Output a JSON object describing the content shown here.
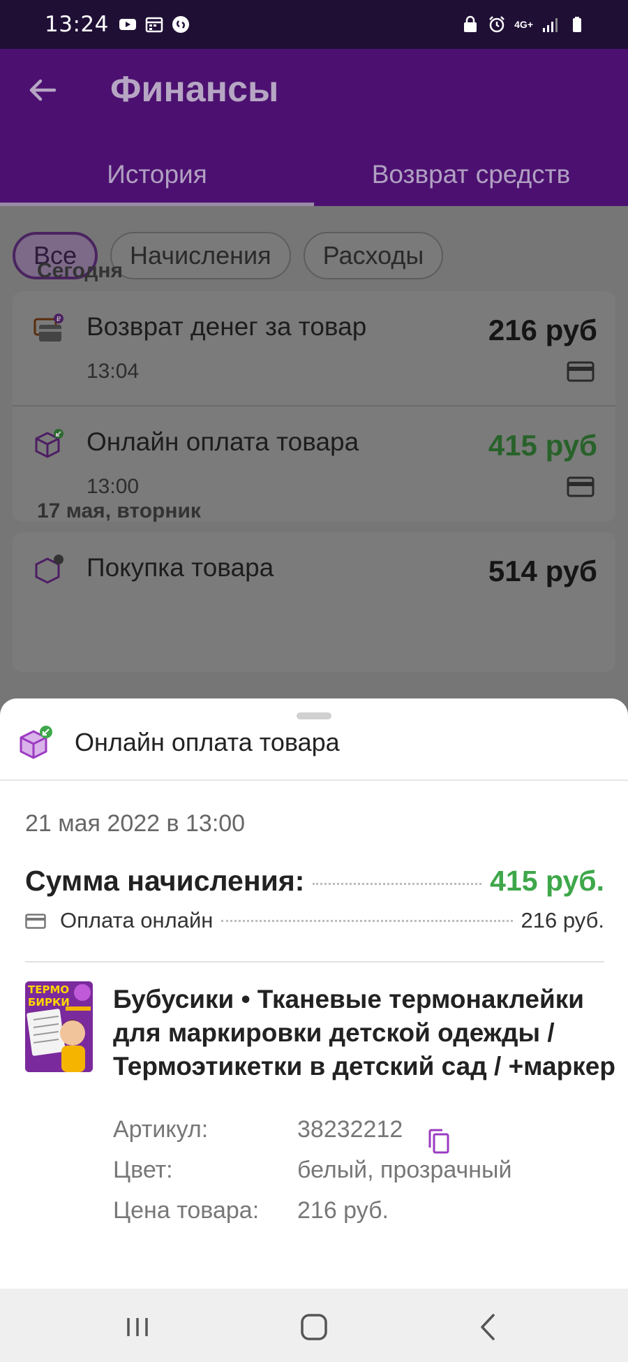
{
  "status_bar": {
    "time": "13:24",
    "network": "4G+"
  },
  "app_bar": {
    "title": "Финансы",
    "tabs": [
      {
        "label": "История",
        "active": true
      },
      {
        "label": "Возврат средств",
        "active": false
      }
    ]
  },
  "filters": {
    "chips": [
      {
        "label": "Все",
        "active": true
      },
      {
        "label": "Начисления",
        "active": false
      },
      {
        "label": "Расходы",
        "active": false
      }
    ]
  },
  "history": {
    "sections": [
      {
        "label": "Сегодня",
        "rows": [
          {
            "title": "Возврат денег за товар",
            "time": "13:04",
            "amount": "216 руб",
            "icon": "wallet-refund-icon",
            "amount_color": "#151515"
          },
          {
            "title": "Онлайн оплата товара",
            "time": "13:00",
            "amount": "415 руб",
            "icon": "box-incoming-icon",
            "amount_color": "#3ea74a"
          }
        ]
      },
      {
        "label": "17 мая, вторник",
        "rows": [
          {
            "title": "Покупка товара",
            "amount": "514 руб",
            "icon": "box-outgoing-icon"
          }
        ]
      }
    ]
  },
  "sheet": {
    "title": "Онлайн оплата товара",
    "date": "21 мая 2022 в 13:00",
    "sum_label": "Сумма начисления:",
    "sum_value": "415 руб.",
    "payment_label": "Оплата онлайн",
    "payment_value": "216 руб.",
    "product": {
      "title": "Бубусики • Тканевые термонаклейки для маркировки детской одежды  / Термоэтикетки в детский сад / +маркер",
      "thumb_text_1": "ТЕРМО",
      "thumb_text_2": "БИРКИ",
      "attributes": [
        {
          "label": "Артикул:",
          "value": "38232212"
        },
        {
          "label": "Цвет:",
          "value": "белый, прозрачный"
        },
        {
          "label": "Цена товара:",
          "value": "216 руб."
        }
      ]
    }
  },
  "colors": {
    "accent_purple": "#4c1170",
    "green": "#3ea74a",
    "icon_purple": "#9b3bc2"
  }
}
